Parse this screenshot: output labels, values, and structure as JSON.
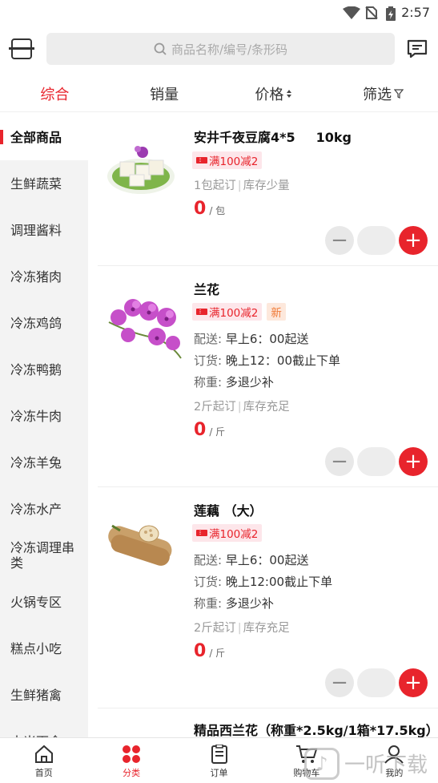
{
  "status": {
    "time": "2:57"
  },
  "search": {
    "placeholder": "商品名称/编号/条形码"
  },
  "sort": [
    {
      "label": "综合"
    },
    {
      "label": "销量"
    },
    {
      "label": "价格"
    },
    {
      "label": "筛选"
    }
  ],
  "categories": [
    "全部商品",
    "生鲜蔬菜",
    "调理酱料",
    "冷冻猪肉",
    "冷冻鸡鸽",
    "冷冻鸭鹅",
    "冷冻牛肉",
    "冷冻羊兔",
    "冷冻水产",
    "冷冻调理串类",
    "火锅专区",
    "糕点小吃",
    "生鲜猪禽",
    "大米面食"
  ],
  "products": [
    {
      "name": "安井千夜豆腐4*5",
      "spec": "10kg",
      "tag": "满100减2",
      "min": "1包起订",
      "stock": "库存少量",
      "price": "0",
      "unit": "/ 包"
    },
    {
      "name": "兰花",
      "tag": "满100减2",
      "new_tag": "新",
      "delivery_label": "配送:",
      "delivery": "早上6：00起送",
      "order_label": "订货:",
      "order": "晚上12：00截止下单",
      "weigh_label": "称重:",
      "weigh": "多退少补",
      "min": "2斤起订",
      "stock": "库存充足",
      "price": "0",
      "unit": "/ 斤"
    },
    {
      "name": "莲藕 （大）",
      "tag": "满100减2",
      "delivery_label": "配送:",
      "delivery": "早上6：00起送",
      "order_label": "订货:",
      "order": "晚上12:00截止下单",
      "weigh_label": "称重:",
      "weigh": "多退少补",
      "min": "2斤起订",
      "stock": "库存充足",
      "price": "0",
      "unit": "/ 斤"
    },
    {
      "name": "精品西兰花（称重*2.5kg/1箱*17.5kg）"
    }
  ],
  "tabs": [
    "首页",
    "分类",
    "订单",
    "购物车",
    "我的"
  ],
  "watermark": "一听下载",
  "colors": {
    "accent": "#e8242c",
    "sidebar": "#f3f3f3"
  }
}
